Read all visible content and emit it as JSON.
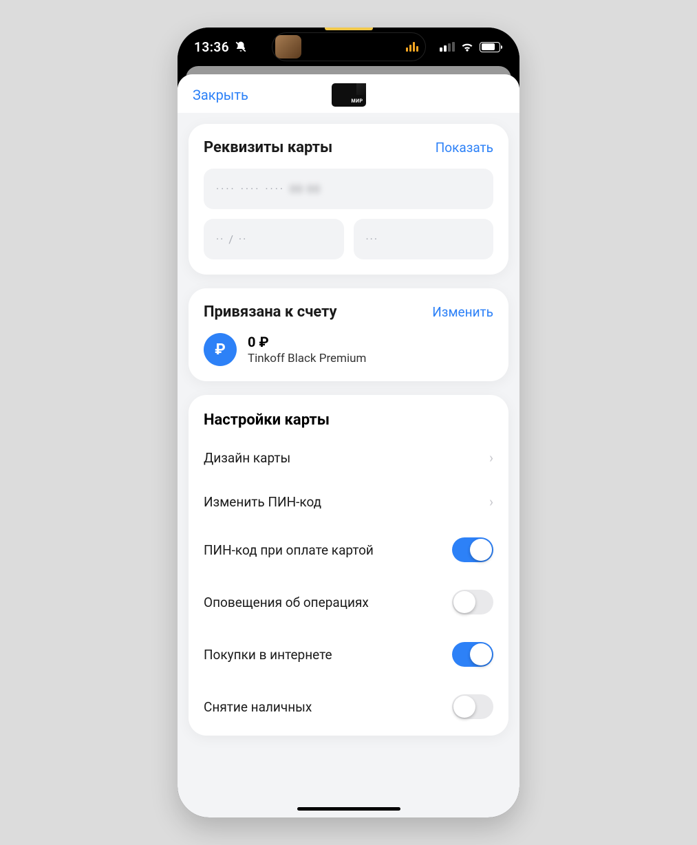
{
  "status": {
    "time": "13:36"
  },
  "header": {
    "close": "Закрыть",
    "card_logo_text": "МИР"
  },
  "details": {
    "title": "Реквизиты карты",
    "action": "Показать",
    "masked_number_dots": "····  ····  ····",
    "masked_number_blur": "00 00",
    "masked_expiry": "·· / ··",
    "masked_cvv": "···"
  },
  "account": {
    "title": "Привязана к счету",
    "action": "Изменить",
    "balance": "0 ₽",
    "name": "Tinkoff Black Premium",
    "currency_symbol": "₽"
  },
  "settings": {
    "title": "Настройки карты",
    "rows": [
      {
        "label": "Дизайн карты",
        "type": "nav"
      },
      {
        "label": "Изменить ПИН-код",
        "type": "nav"
      },
      {
        "label": "ПИН-код при оплате картой",
        "type": "toggle",
        "on": true
      },
      {
        "label": "Оповещения об операциях",
        "type": "toggle",
        "on": false
      },
      {
        "label": "Покупки в интернете",
        "type": "toggle",
        "on": true
      },
      {
        "label": "Снятие наличных",
        "type": "toggle",
        "on": false
      }
    ]
  }
}
